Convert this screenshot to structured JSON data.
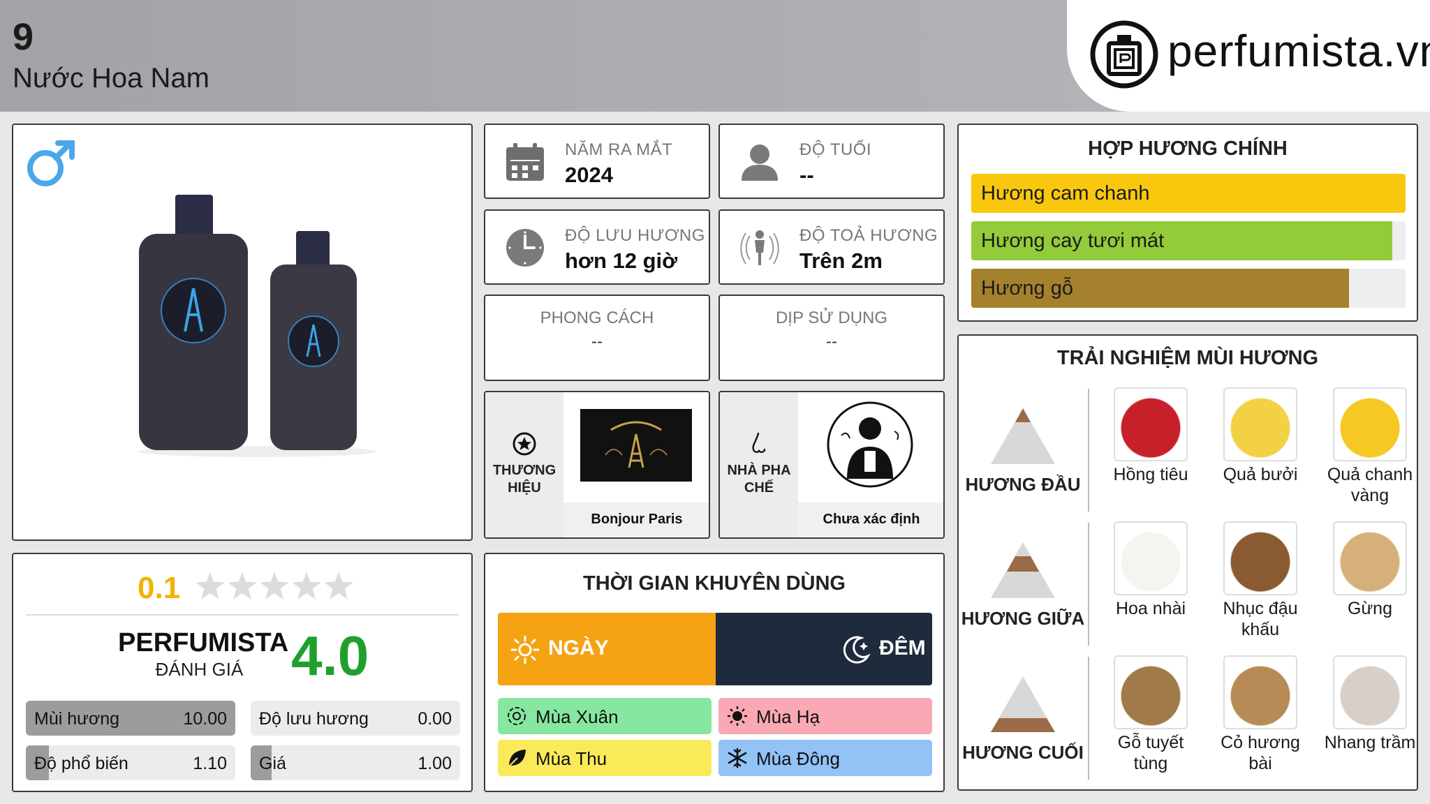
{
  "header": {
    "number": "9",
    "category": "Nước Hoa Nam",
    "logo_text": "perfumista.vn"
  },
  "info": {
    "launch_year": {
      "label": "NĂM RA MẮT",
      "value": "2024",
      "icon": "calendar-icon"
    },
    "age": {
      "label": "ĐỘ TUỔI",
      "value": "--",
      "icon": "user-icon"
    },
    "longevity": {
      "label": "ĐỘ LƯU HƯƠNG",
      "value": "hơn 12 giờ",
      "icon": "clock-icon"
    },
    "sillage": {
      "label": "ĐỘ TOẢ HƯƠNG",
      "value": "Trên 2m",
      "icon": "person-aura-icon"
    },
    "style": {
      "label": "PHONG CÁCH",
      "value": "--"
    },
    "occasion": {
      "label": "DỊP SỬ DỤNG",
      "value": "--"
    },
    "brand": {
      "label": "THƯƠNG HIỆU",
      "name": "Bonjour Paris",
      "icon": "star-circle-icon"
    },
    "perfumer": {
      "label": "NHÀ PHA CHẾ",
      "name": "Chưa xác định",
      "icon": "nose-icon"
    }
  },
  "accords": {
    "title": "HỢP HƯƠNG CHÍNH",
    "items": [
      {
        "name": "Hương cam chanh",
        "level": 100,
        "color": "#f9c80e"
      },
      {
        "name": "Hương cay tươi mát",
        "level": 97,
        "color": "#93cb3a"
      },
      {
        "name": "Hương gỗ",
        "level": 87,
        "color": "#a5812e"
      }
    ]
  },
  "experience": {
    "title": "TRẢI NGHIỆM MÙI HƯƠNG",
    "top": {
      "label": "HƯƠNG ĐẦU",
      "notes": [
        "Hồng tiêu",
        "Quả bưởi",
        "Quả chanh vàng"
      ]
    },
    "middle": {
      "label": "HƯƠNG GIỮA",
      "notes": [
        "Hoa nhài",
        "Nhục đậu khấu",
        "Gừng"
      ]
    },
    "base": {
      "label": "HƯƠNG CUỐI",
      "notes": [
        "Gỗ tuyết tùng",
        "Cỏ hương bài",
        "Nhang trầm"
      ]
    }
  },
  "rating": {
    "user_score": "0.1",
    "user_stars": 0.02,
    "brand": "PERFUMISTA",
    "brand_sub": "ĐÁNH GIÁ",
    "score": "4.0",
    "metrics": [
      {
        "name": "Mùi hương",
        "value": "10.00",
        "level": 1.0
      },
      {
        "name": "Độ lưu hương",
        "value": "0.00",
        "level": 0.0
      },
      {
        "name": "Độ phổ biến",
        "value": "1.10",
        "level": 0.11
      },
      {
        "name": "Giá",
        "value": "1.00",
        "level": 0.1
      }
    ]
  },
  "time": {
    "title": "THỜI GIAN KHUYÊN DÙNG",
    "day": "NGÀY",
    "night": "ĐÊM",
    "seasons": [
      {
        "name": "Mùa Xuân",
        "color": "#86e8a0",
        "icon": "flower-icon"
      },
      {
        "name": "Mùa Hạ",
        "color": "#f9a8b4",
        "icon": "sun-icon"
      },
      {
        "name": "Mùa Thu",
        "color": "#faea5a",
        "icon": "leaf-icon"
      },
      {
        "name": "Mùa Đông",
        "color": "#92c2f6",
        "icon": "snowflake-icon"
      }
    ]
  }
}
